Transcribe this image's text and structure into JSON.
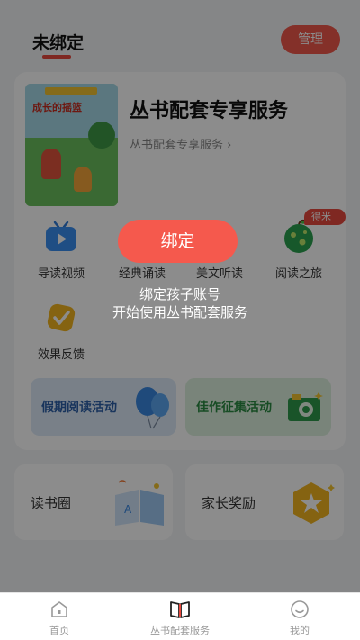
{
  "header": {
    "title": "未绑定",
    "manage_label": "管理"
  },
  "service": {
    "book_title": "成长的摇篮",
    "title": "丛书配套专享服务",
    "subtitle": "丛书配套专享服务 ›"
  },
  "grid": [
    {
      "label": "导读视频",
      "icon": "tv-icon"
    },
    {
      "label": "经典诵读",
      "icon": "microphone-icon"
    },
    {
      "label": "美文听读",
      "icon": "headphones-icon"
    },
    {
      "label": "阅读之旅",
      "icon": "globe-icon"
    },
    {
      "label": "效果反馈",
      "icon": "check-badge-icon"
    }
  ],
  "coin_tag": "得米币",
  "banners": [
    {
      "label": "假期阅读活动",
      "color": "#2d5fa8"
    },
    {
      "label": "佳作征集活动",
      "color": "#2a8a43"
    }
  ],
  "cards": [
    {
      "label": "读书圈"
    },
    {
      "label": "家长奖励"
    }
  ],
  "overlay": {
    "bind_label": "绑定",
    "line1": "绑定孩子账号",
    "line2": "开始使用丛书配套服务"
  },
  "tabbar": [
    {
      "label": "首页",
      "icon": "home-icon"
    },
    {
      "label": "丛书配套服务",
      "icon": "open-book-icon"
    },
    {
      "label": "我的",
      "icon": "smiley-icon"
    }
  ],
  "colors": {
    "accent": "#e8493e",
    "overlay": "rgba(0,0,0,0.45)"
  }
}
